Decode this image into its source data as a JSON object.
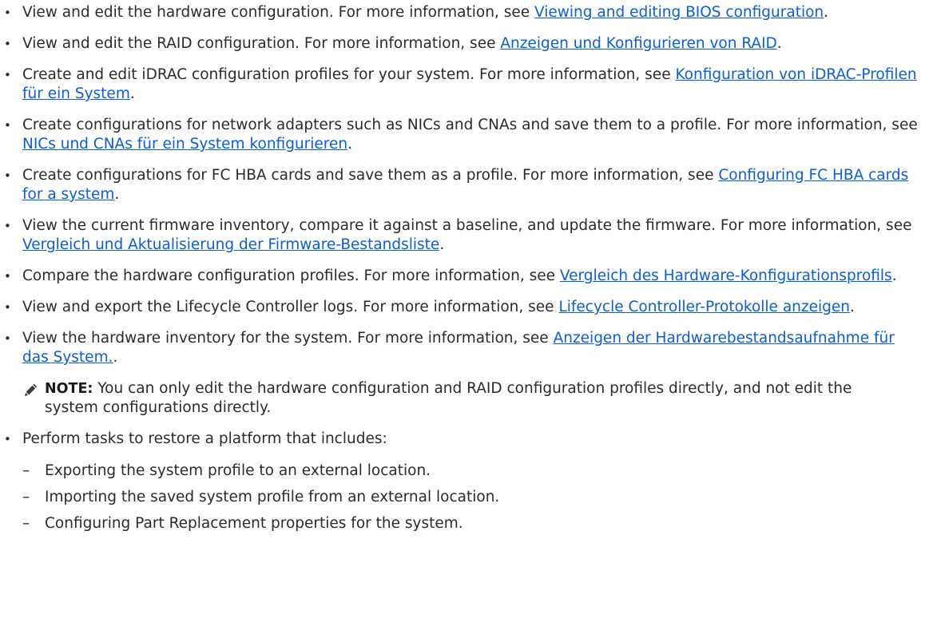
{
  "items": [
    {
      "text": "View and edit the hardware configuration. For more information, see ",
      "link": "Viewing and editing BIOS configuration",
      "suffix": "."
    },
    {
      "text": "View and edit the RAID configuration. For more information, see ",
      "link": "Anzeigen und Konfigurieren von RAID",
      "suffix": "."
    },
    {
      "text": "Create and edit iDRAC configuration profiles for your system. For more information, see ",
      "link": "Konfiguration von iDRAC-Profilen für ein System",
      "suffix": "."
    },
    {
      "text": "Create configurations for network adapters such as NICs and CNAs and save them to a profile. For more information, see ",
      "link": "NICs und CNAs für ein System konfigurieren",
      "suffix": "."
    },
    {
      "text": "Create configurations for FC HBA cards and save them as a profile. For more information, see ",
      "link": "Configuring FC HBA cards for a system",
      "suffix": "."
    },
    {
      "text": "View the current firmware inventory, compare it against a baseline, and update the firmware. For more information, see ",
      "link": "Vergleich und Aktualisierung der Firmware-Bestandsliste",
      "suffix": "."
    },
    {
      "text": "Compare the hardware configuration profiles. For more information, see ",
      "link": "Vergleich des Hardware-Konfigurationsprofils",
      "suffix": "."
    },
    {
      "text": "View and export the Lifecycle Controller logs. For more information, see ",
      "link": "Lifecycle Controller-Protokolle anzeigen",
      "suffix": "."
    },
    {
      "text": "View the hardware inventory for the system. For more information, see ",
      "link": "Anzeigen der Hardwarebestandsaufnahme für das System.",
      "suffix": "."
    }
  ],
  "note": {
    "label": "NOTE:",
    "text": " You can only edit the hardware configuration and RAID configuration profiles directly, and not edit the system configurations directly."
  },
  "last_item": {
    "text": "Perform tasks to restore a platform that includes:",
    "sub_items": [
      "Exporting the system profile to an external location.",
      "Importing the saved system profile from an external location.",
      "Configuring Part Replacement properties for the system."
    ]
  },
  "symbols": {
    "bullet": "•",
    "dash": "–"
  },
  "icons": {
    "note": "pencil-icon"
  },
  "colors": {
    "link": "#0a5fd6",
    "text": "#2b2b2b"
  }
}
